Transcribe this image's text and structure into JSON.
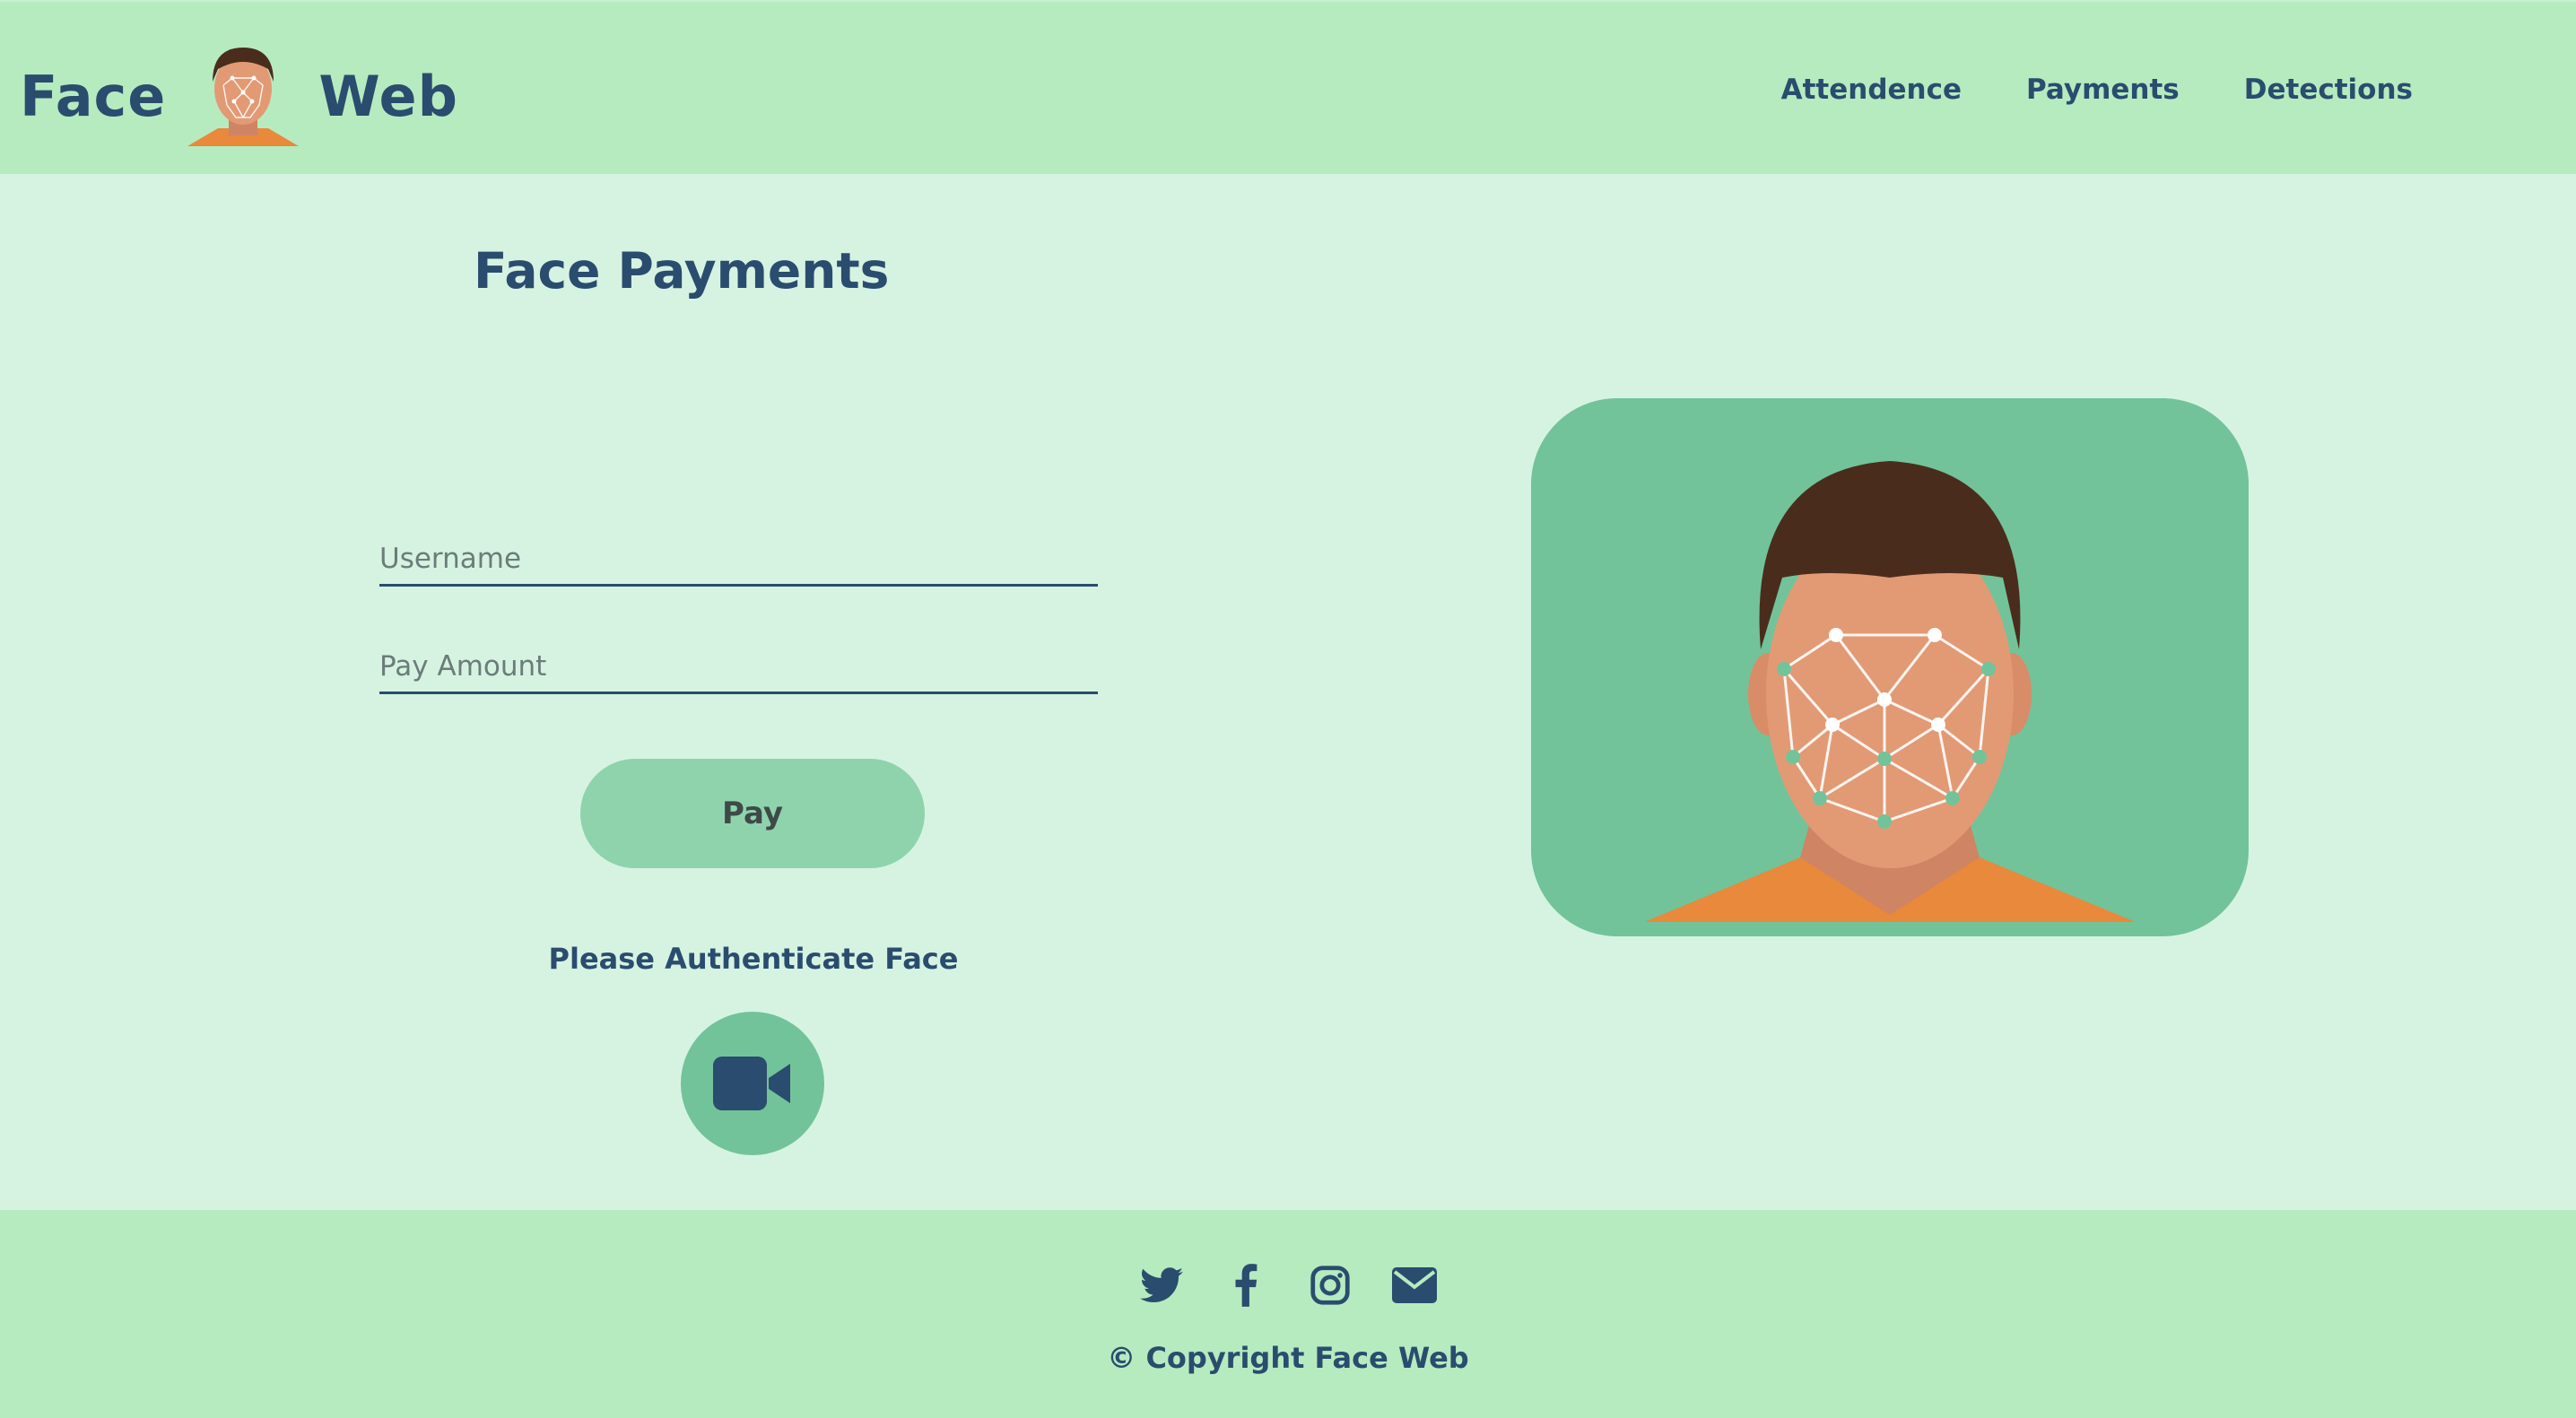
{
  "header": {
    "brand_left": "Face",
    "brand_right": "Web",
    "logo_icon": "face-scan-avatar-icon",
    "nav": [
      {
        "label": "Attendence"
      },
      {
        "label": "Payments"
      },
      {
        "label": "Detections"
      }
    ]
  },
  "main": {
    "title": "Face Payments",
    "username_placeholder": "Username",
    "amount_placeholder": "Pay Amount",
    "pay_label": "Pay",
    "auth_prompt": "Please Authenticate Face",
    "camera_icon": "video-camera-icon",
    "illustration_icon": "face-recognition-illustration"
  },
  "footer": {
    "socials": [
      "twitter-icon",
      "facebook-icon",
      "instagram-icon",
      "envelope-icon"
    ],
    "copyright": "© Copyright Face Web"
  },
  "colors": {
    "header_bg": "#b6ebbf",
    "page_bg": "#d6f3e2",
    "text_primary": "#2a4c6e",
    "accent_green": "#72c39a",
    "button_green": "#8fd3ad",
    "shirt_orange": "#e8893b",
    "hair_brown": "#4a2c1d",
    "skin": "#e29a74"
  }
}
